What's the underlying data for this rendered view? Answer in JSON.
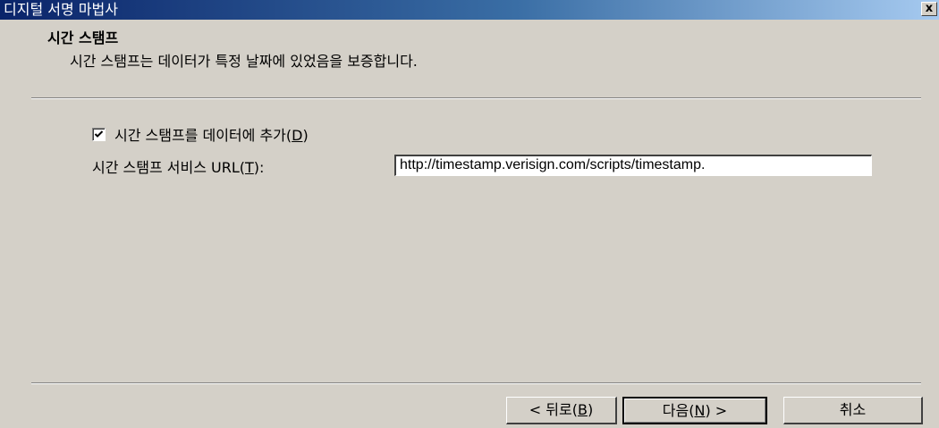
{
  "window": {
    "title": "디지털 서명 마법사",
    "close_glyph": "x"
  },
  "header": {
    "title": "시간 스탬프",
    "subtitle": "시간 스탬프는 데이터가 특정 날짜에 있었음을 보증합니다."
  },
  "form": {
    "add_timestamp": {
      "label_prefix": "시간 스탬프를 데이터에 추가(",
      "access_key": "D",
      "label_suffix": ")",
      "checked": true
    },
    "url_field": {
      "label_prefix": "시간 스탬프 서비스 URL(",
      "access_key": "T",
      "label_suffix": "):",
      "value": "http://timestamp.verisign.com/scripts/timestamp."
    }
  },
  "buttons": {
    "back": {
      "prefix": "< 뒤로(",
      "key": "B",
      "suffix": ")"
    },
    "next": {
      "prefix": "다음(",
      "key": "N",
      "suffix": ") >"
    },
    "cancel": {
      "label": "취소"
    }
  }
}
